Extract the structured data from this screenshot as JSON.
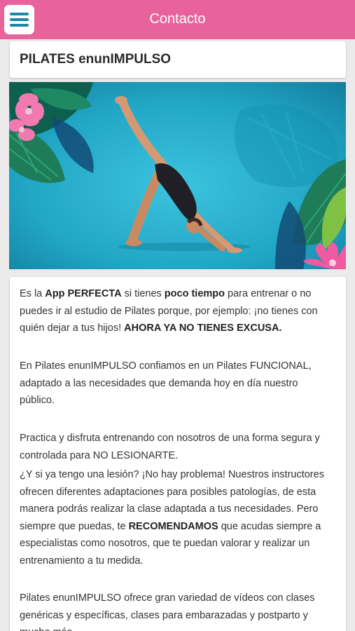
{
  "header": {
    "title": "Contacto",
    "menu_icon": "hamburger-icon",
    "bg_color": "#e8639c"
  },
  "page_title": "PILATES enunIMPULSO",
  "hero_image": {
    "subject": "person-in-downward-dog-pilates-pose"
  },
  "intro": {
    "t1": "Es la ",
    "b1": "App PERFECTA",
    "t2": " si tienes ",
    "b2": "poco tiempo",
    "t3": " para entrenar o no puedes ir al estudio de Pilates porque, por ejemplo: ¡no tienes con quién dejar a tus hijos! ",
    "b3": "AHORA YA NO TIENES EXCUSA."
  },
  "paragraph_2": "En Pilates enunIMPULSO confiamos en un Pilates FUNCIONAL, adaptado a las necesidades que demanda hoy en día nuestro público.",
  "paragraph_3": "Practica y disfruta entrenando con nosotros de una forma segura y controlada para NO LESIONARTE.",
  "paragraph_4": {
    "t1": "¿Y si ya tengo una lesión? ¡No hay problema! Nuestros instructores ofrecen diferentes adaptaciones para posibles patologías, de esta manera podrás realizar la clase adaptada a tus necesidades. Pero siempre que puedas, te ",
    "b1": "RECOMENDAMOS",
    "t2": " que acudas siempre a especialistas como nosotros, que te puedan valorar y realizar un entrenamiento a tu medida."
  },
  "paragraph_5": "Pilates enunIMPULSO ofrece gran variedad de vídeos con clases genéricas y específicas, clases para embarazadas y postparto y mucho más..."
}
